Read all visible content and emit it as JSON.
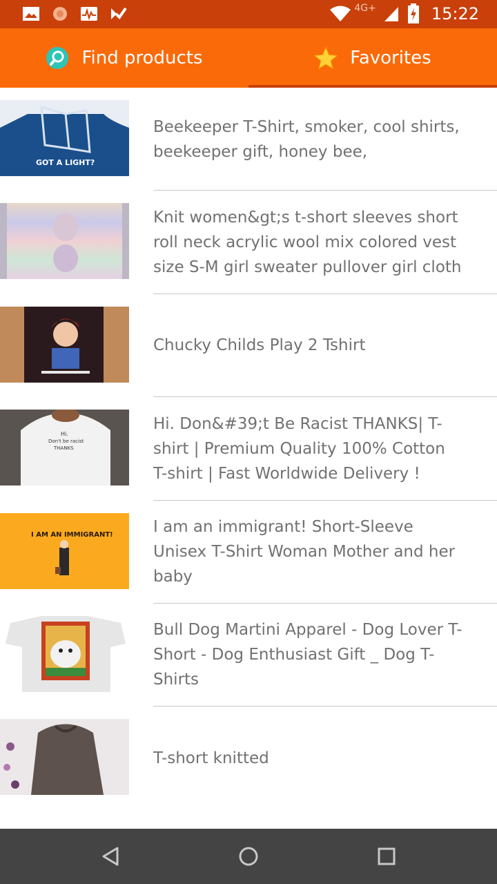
{
  "status_bar": {
    "time": "15:22",
    "network": "4G+",
    "icons": [
      "image-icon",
      "settings-sun-icon",
      "pulse-icon",
      "check-flag-icon",
      "wifi-icon",
      "signal-icon",
      "battery-charging-icon"
    ]
  },
  "tabs": [
    {
      "label": "Find products",
      "icon": "search-globe-icon",
      "selected": false
    },
    {
      "label": "Favorites",
      "icon": "star-icon",
      "selected": true
    }
  ],
  "products": [
    {
      "title": "Beekeeper T-Shirt, smoker, cool shirts, beekeeper gift, honey bee,",
      "thumb_text": "GOT A LIGHT?"
    },
    {
      "title": "Knit women&gt;s t-short sleeves short roll neck acrylic wool  mix colored vest size S-M girl sweater pullover girl cloth"
    },
    {
      "title": "Chucky Childs Play 2 Tshirt"
    },
    {
      "title": "Hi. Don&#39;t Be Racist THANKS| T-shirt  | Premium Quality 100% Cotton T-shirt  | Fast Worldwide Delivery !",
      "thumb_text": "Hi. Don't be racist THANKS"
    },
    {
      "title": "I am an immigrant! Short-Sleeve Unisex T-Shirt Woman Mother and her baby",
      "thumb_text": "I AM AN IMMIGRANT!"
    },
    {
      "title": "Bull Dog Martini Apparel - Dog Lover T-Short - Dog Enthusiast Gift _ Dog T-Shirts"
    },
    {
      "title": "T-short knitted"
    }
  ],
  "colors": {
    "status_bar": "#c9400a",
    "tab_bar": "#fb6a09",
    "tab_indicator": "#c9400a",
    "text": "#717171",
    "divider": "#c7c7c7",
    "nav_bar": "#444444"
  },
  "nav": [
    "back-icon",
    "home-icon",
    "recents-icon"
  ]
}
